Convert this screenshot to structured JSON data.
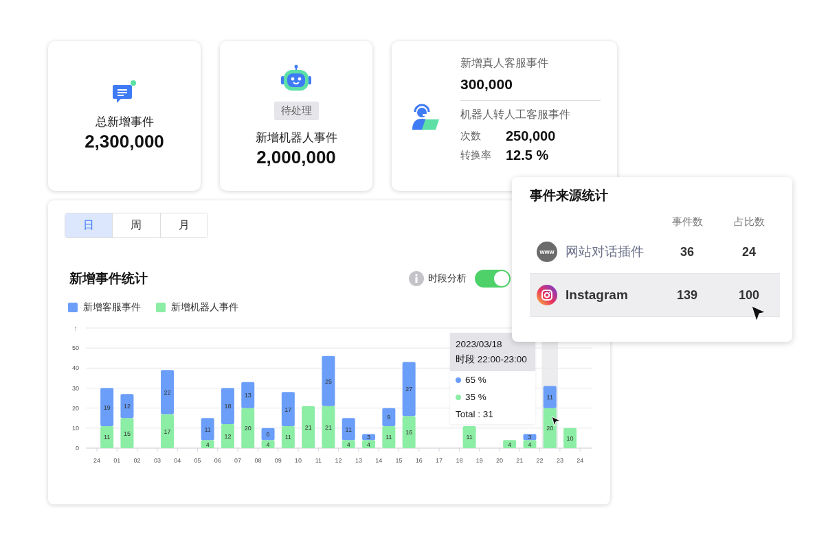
{
  "cards": [
    {
      "kind": "simple",
      "label": "总新增事件",
      "value": "2,300,000"
    },
    {
      "kind": "badge",
      "badge": "待处理",
      "label": "新增机器人事件",
      "value": "2,000,000"
    },
    {
      "kind": "split",
      "label": "新增真人客服事件",
      "value": "300,000",
      "sub_label": "机器人转人工客服事件",
      "rows": [
        {
          "label": "次数",
          "value": "250,000"
        },
        {
          "label": "转换率",
          "value": "12.5 %"
        }
      ]
    }
  ],
  "period_tabs": [
    {
      "label": "日",
      "selected": true
    },
    {
      "label": "周",
      "selected": false
    },
    {
      "label": "月",
      "selected": false
    }
  ],
  "chart_panel": {
    "title": "新增事件统计",
    "toggle_label": "时段分析",
    "toggle_on": true,
    "axis_mark": "↑",
    "x_axis_end_label": "24",
    "chart_data": {
      "type": "bar",
      "stacked": true,
      "data_labels": true,
      "grid": true,
      "ylim": [
        0,
        60
      ],
      "yticks": [
        0,
        10,
        20,
        30,
        40,
        50
      ],
      "categories": [
        "24",
        "01",
        "02",
        "03",
        "04",
        "05",
        "06",
        "07",
        "08",
        "09",
        "10",
        "11",
        "12",
        "13",
        "14",
        "15",
        "16",
        "17",
        "18",
        "19",
        "20",
        "21",
        "22",
        "23"
      ],
      "series": [
        {
          "name": "新增机器人事件",
          "color": "#8ceda4",
          "values": [
            11,
            15,
            null,
            17,
            null,
            4,
            12,
            20,
            4,
            11,
            21,
            21,
            4,
            4,
            11,
            16,
            null,
            null,
            11,
            null,
            4,
            4,
            20,
            10
          ]
        },
        {
          "name": "新增客服事件",
          "color": "#6a9ef8",
          "values": [
            19,
            12,
            null,
            22,
            null,
            11,
            18,
            13,
            6,
            17,
            null,
            25,
            11,
            3,
            9,
            27,
            null,
            null,
            null,
            null,
            null,
            3,
            11,
            null
          ]
        }
      ]
    },
    "tooltip": {
      "date": "2023/03/18",
      "period": "时段 22:00-23:00",
      "items": [
        {
          "text": "65 %",
          "color": "#6a9ef8"
        },
        {
          "text": "35 %",
          "color": "#8ceda4"
        }
      ],
      "total": "Total : 31"
    }
  },
  "source_popup": {
    "title": "事件来源统计",
    "columns": [
      "事件数",
      "占比数"
    ],
    "rows": [
      {
        "kind": "web",
        "icon_text": "www",
        "name": "网站对话插件",
        "count": "36",
        "share": "24",
        "selected": false
      },
      {
        "kind": "instagram",
        "name": "Instagram",
        "count": "139",
        "share": "100",
        "selected": true
      }
    ]
  }
}
